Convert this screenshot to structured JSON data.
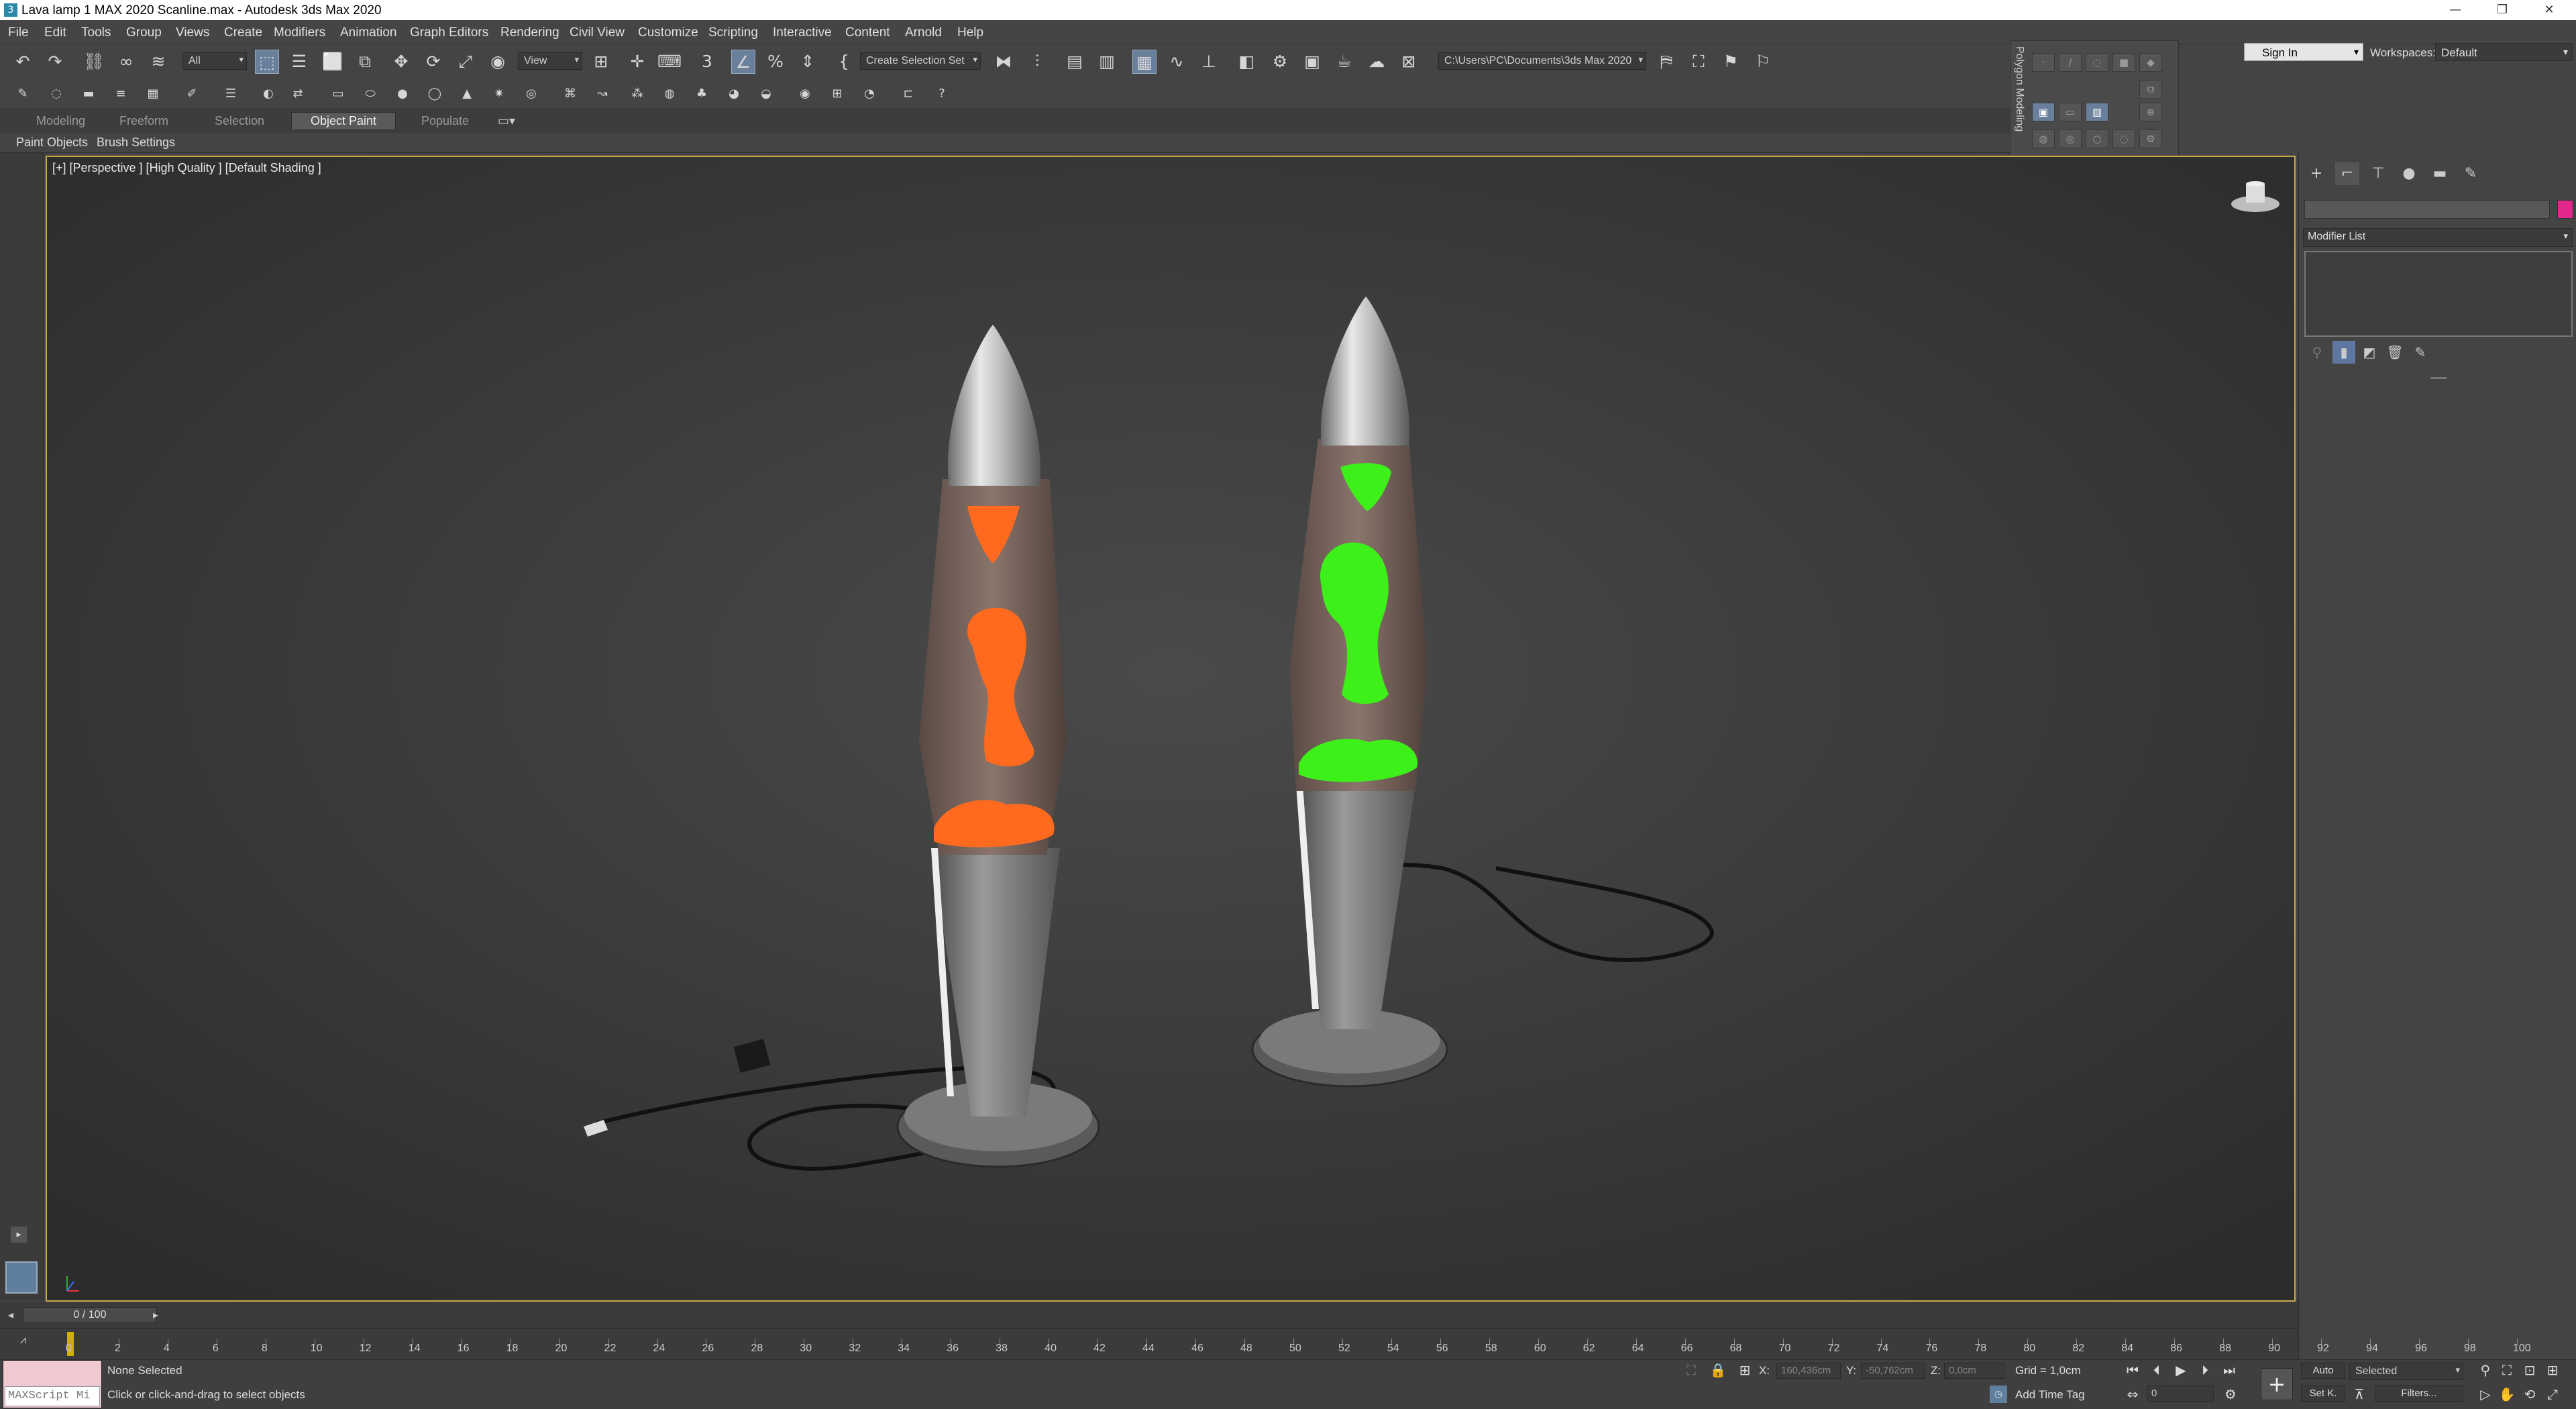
{
  "window": {
    "title": "Lava lamp 1 MAX 2020 Scanline.max - Autodesk 3ds Max 2020",
    "app_icon": "3"
  },
  "window_controls": {
    "minimize": "—",
    "restore": "❐",
    "close": "✕"
  },
  "menus": [
    "File",
    "Edit",
    "Tools",
    "Group",
    "Views",
    "Create",
    "Modifiers",
    "Animation",
    "Graph Editors",
    "Rendering",
    "Civil View",
    "Customize",
    "Scripting",
    "Interactive",
    "Content",
    "Arnold",
    "Help"
  ],
  "account": {
    "signin_label": "Sign In",
    "workspaces_label": "Workspaces:",
    "workspace_value": "Default"
  },
  "toolbar": {
    "selection_filter": "All",
    "ref_coord": "View",
    "named_sel": "Create Selection Set",
    "project_path": "C:\\Users\\PC\\Documents\\3ds Max 2020",
    "snap_label": "3",
    "angle_snap": "%"
  },
  "ribbon": {
    "tabs": [
      "Modeling",
      "Freeform",
      "Selection",
      "Object Paint",
      "Populate"
    ],
    "active_tab": "Object Paint",
    "sub_items": [
      "Paint Objects",
      "Brush Settings"
    ]
  },
  "polygon_panel": {
    "label": "Polygon Modeling"
  },
  "viewport": {
    "label": "[+] [Perspective ] [High Quality ] [Default Shading ]"
  },
  "command_panel": {
    "modifier_list": "Modifier List",
    "color_swatch": "#e0288c"
  },
  "timeline": {
    "slider": "0 / 100",
    "ticks": [
      "0",
      "2",
      "4",
      "6",
      "8",
      "10",
      "12",
      "14",
      "16",
      "18",
      "20",
      "22",
      "24",
      "26",
      "28",
      "30",
      "32",
      "34",
      "36",
      "38",
      "40",
      "42",
      "44",
      "46",
      "48",
      "50",
      "52",
      "54",
      "56",
      "58",
      "60",
      "62",
      "64",
      "66",
      "68",
      "70",
      "72",
      "74",
      "76",
      "78",
      "80",
      "82",
      "84",
      "86",
      "88",
      "90",
      "92",
      "94",
      "96",
      "98",
      "100"
    ]
  },
  "status": {
    "maxscript": "MAXScript Mi",
    "selection": "None Selected",
    "prompt": "Click or click-and-drag to select objects",
    "x_label": "X:",
    "x_value": "160,436cm",
    "y_label": "Y:",
    "y_value": "-50,762cm",
    "z_label": "Z:",
    "z_value": "0,0cm",
    "grid": "Grid = 1,0cm",
    "add_time_tag": "Add Time Tag",
    "auto": "Auto",
    "selected": "Selected",
    "set_key": "Set K.",
    "filters": "Filters...",
    "frame": "0"
  },
  "scene_colors": {
    "lamp_left_lava": "#ff6a1f",
    "lamp_right_lava": "#3ef01a",
    "grid_bg": "#3a3a3a"
  }
}
